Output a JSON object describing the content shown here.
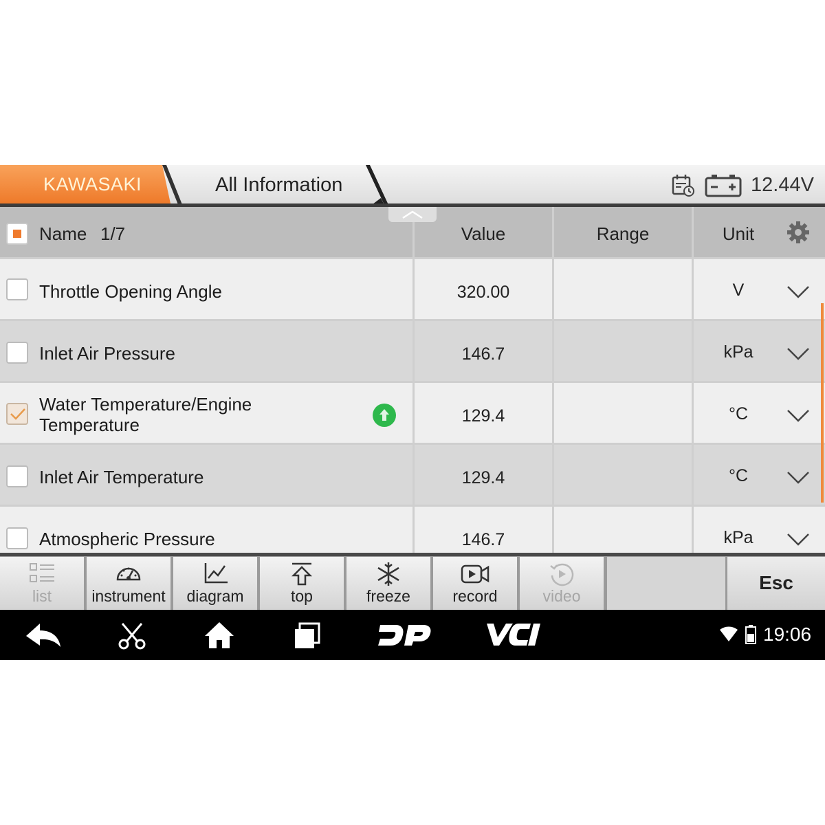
{
  "header": {
    "brand": "KAWASAKI",
    "section": "All Information",
    "voltage": "12.44V",
    "icons": [
      "calendar-clock-icon",
      "battery-icon"
    ]
  },
  "table": {
    "columns": {
      "name": "Name",
      "page": "1/7",
      "value": "Value",
      "range": "Range",
      "unit": "Unit"
    },
    "rows": [
      {
        "name": "Throttle Opening Angle",
        "value": "320.00",
        "range": "",
        "unit": "V",
        "checked": false
      },
      {
        "name": "Inlet Air Pressure",
        "value": "146.7",
        "range": "",
        "unit": "kPa",
        "checked": false
      },
      {
        "name": "Water Temperature/Engine Temperature",
        "value": "129.4",
        "range": "",
        "unit": "°C",
        "checked": true
      },
      {
        "name": "Inlet Air Temperature",
        "value": "129.4",
        "range": "",
        "unit": "°C",
        "checked": false
      },
      {
        "name": "Atmospheric Pressure",
        "value": "146.7",
        "range": "",
        "unit": "kPa",
        "checked": false
      }
    ]
  },
  "toolbar": {
    "buttons": [
      {
        "label": "list",
        "icon": "list-icon",
        "enabled": false
      },
      {
        "label": "instrument",
        "icon": "gauge-icon",
        "enabled": true
      },
      {
        "label": "diagram",
        "icon": "line-chart-icon",
        "enabled": true
      },
      {
        "label": "top",
        "icon": "pin-top-icon",
        "enabled": true
      },
      {
        "label": "freeze",
        "icon": "snowflake-icon",
        "enabled": true
      },
      {
        "label": "record",
        "icon": "camera-icon",
        "enabled": true
      },
      {
        "label": "video",
        "icon": "replay-icon",
        "enabled": false
      }
    ],
    "esc": "Esc"
  },
  "navbar": {
    "time": "19:06",
    "icons": [
      "back-icon",
      "scissors-icon",
      "home-icon",
      "recent-apps-icon",
      "dp-logo",
      "vci-logo",
      "wifi-icon",
      "battery-status-icon"
    ]
  },
  "colors": {
    "accent": "#ee7a2a",
    "navbar": "#000000",
    "header_bg": "#dcdcdc"
  }
}
